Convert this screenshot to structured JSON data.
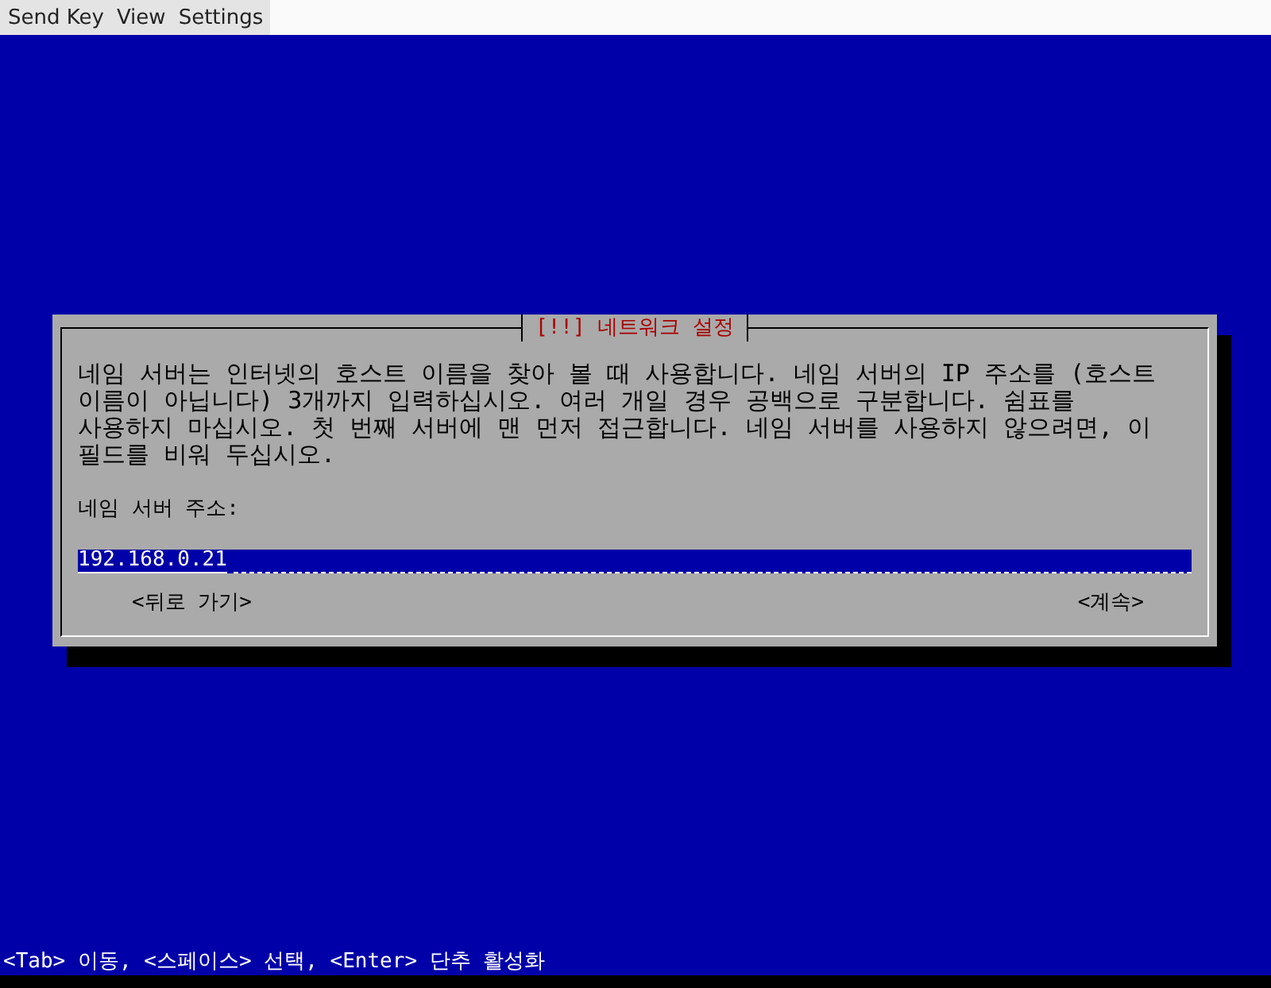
{
  "menu_bar": {
    "items": [
      "Send Key",
      "View",
      "Settings"
    ]
  },
  "dialog": {
    "title": "[!!] 네트워크 설정",
    "description": "네임 서버는 인터넷의 호스트 이름을 찾아 볼 때 사용합니다. 네임 서버의 IP 주소를 (호스트\n이름이 아닙니다) 3개까지 입력하십시오. 여러 개일 경우 공백으로 구분합니다. 쉼표를\n사용하지 마십시오. 첫 번째 서버에 맨 먼저 접근합니다. 네임 서버를 사용하지 않으려면, 이\n필드를 비워 두십시오.",
    "field_label": "네임 서버 주소:",
    "field_value": "192.168.0.21",
    "buttons": [
      "<뒤로 가기>",
      "<계속>"
    ]
  },
  "status_bar": "<Tab> 이동, <스페이스> 선택, <Enter> 단추 활성화"
}
